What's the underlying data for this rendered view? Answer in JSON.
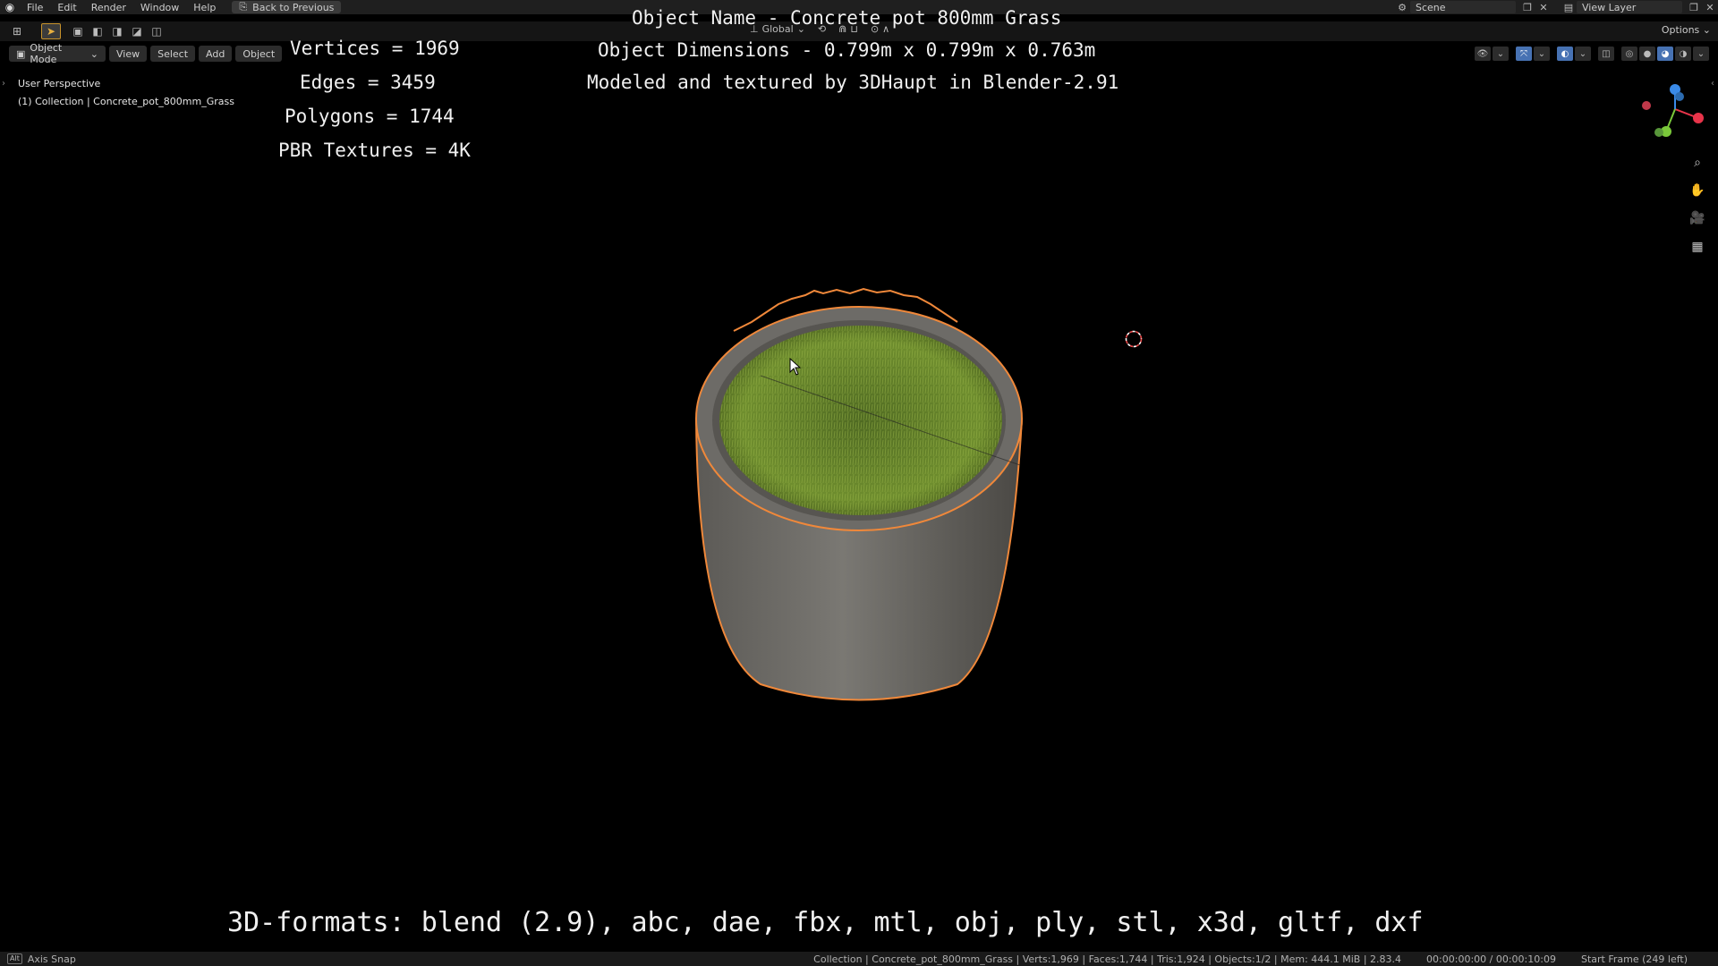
{
  "topbar": {
    "menus": [
      "File",
      "Edit",
      "Render",
      "Window",
      "Help"
    ],
    "back_button": "Back to Previous",
    "scene_name": "Scene",
    "view_layer": "View Layer"
  },
  "tool_header": {
    "orientation": "Global",
    "options": "Options"
  },
  "view_header": {
    "mode": "Object Mode",
    "menus": [
      "View",
      "Select",
      "Add",
      "Object"
    ]
  },
  "viewport": {
    "perspective": "User Perspective",
    "collection": "(1) Collection | Concrete_pot_800mm_Grass"
  },
  "overlay": {
    "vertices": "Vertices = 1969",
    "edges": "Edges = 3459",
    "polygons": "Polygons = 1744",
    "textures": "PBR Textures = 4K",
    "object_name": "Object Name - Concrete pot 800mm Grass",
    "dimensions": "Object Dimensions -  0.799m x 0.799m x 0.763m",
    "credit": "Modeled and textured by 3DHaupt in Blender-2.91",
    "formats": "3D-formats: blend (2.9), abc, dae, fbx, mtl, obj, ply, stl, x3d, gltf, dxf"
  },
  "statusbar": {
    "hint": "Axis Snap",
    "stats": "Collection | Concrete_pot_800mm_Grass | Verts:1,969 | Faces:1,744 | Tris:1,924 | Objects:1/2 | Mem: 444.1 MiB | 2.83.4",
    "time": "00:00:00:00 / 00:00:10:09",
    "frame": "Start Frame (249 left)"
  },
  "colors": {
    "selection_outline": "#f0883a",
    "active_tool": "#e8b040",
    "gizmo_x": "#e8344a",
    "gizmo_y": "#7ac83a",
    "gizmo_z": "#3a8ae8"
  }
}
